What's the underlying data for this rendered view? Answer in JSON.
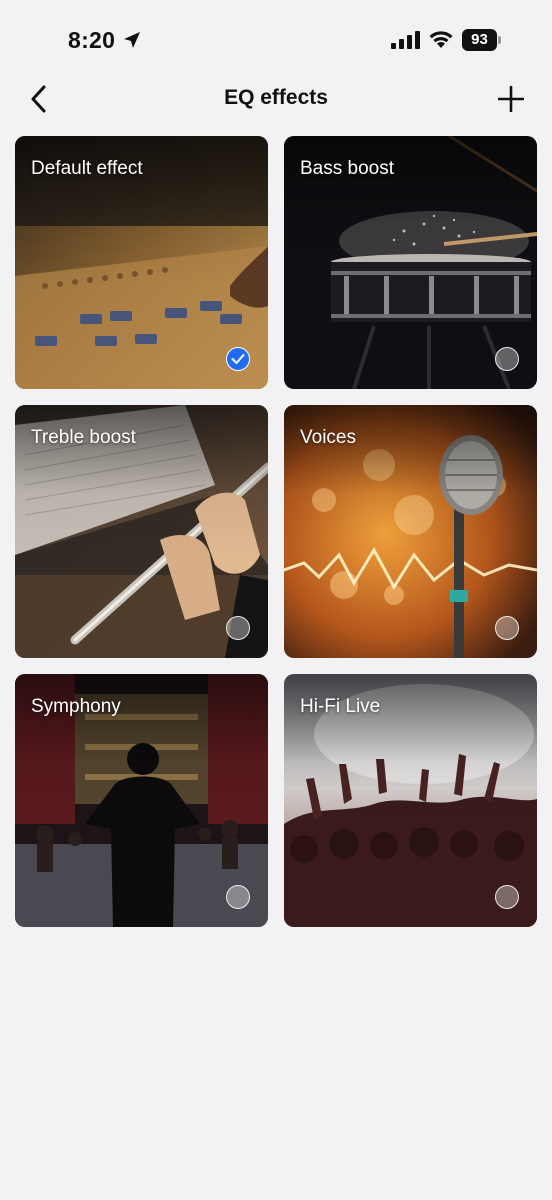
{
  "status": {
    "time": "8:20",
    "battery": "93"
  },
  "header": {
    "title": "EQ effects",
    "back_icon": "chevron-left-icon",
    "add_icon": "plus-icon"
  },
  "effects": [
    {
      "label": "Default effect",
      "selected": true
    },
    {
      "label": "Bass boost",
      "selected": false
    },
    {
      "label": "Treble boost",
      "selected": false
    },
    {
      "label": "Voices",
      "selected": false
    },
    {
      "label": "Symphony",
      "selected": false
    },
    {
      "label": "Hi-Fi Live",
      "selected": false
    }
  ],
  "colors": {
    "accent": "#1f6cf2",
    "background": "#f2f2f4"
  }
}
